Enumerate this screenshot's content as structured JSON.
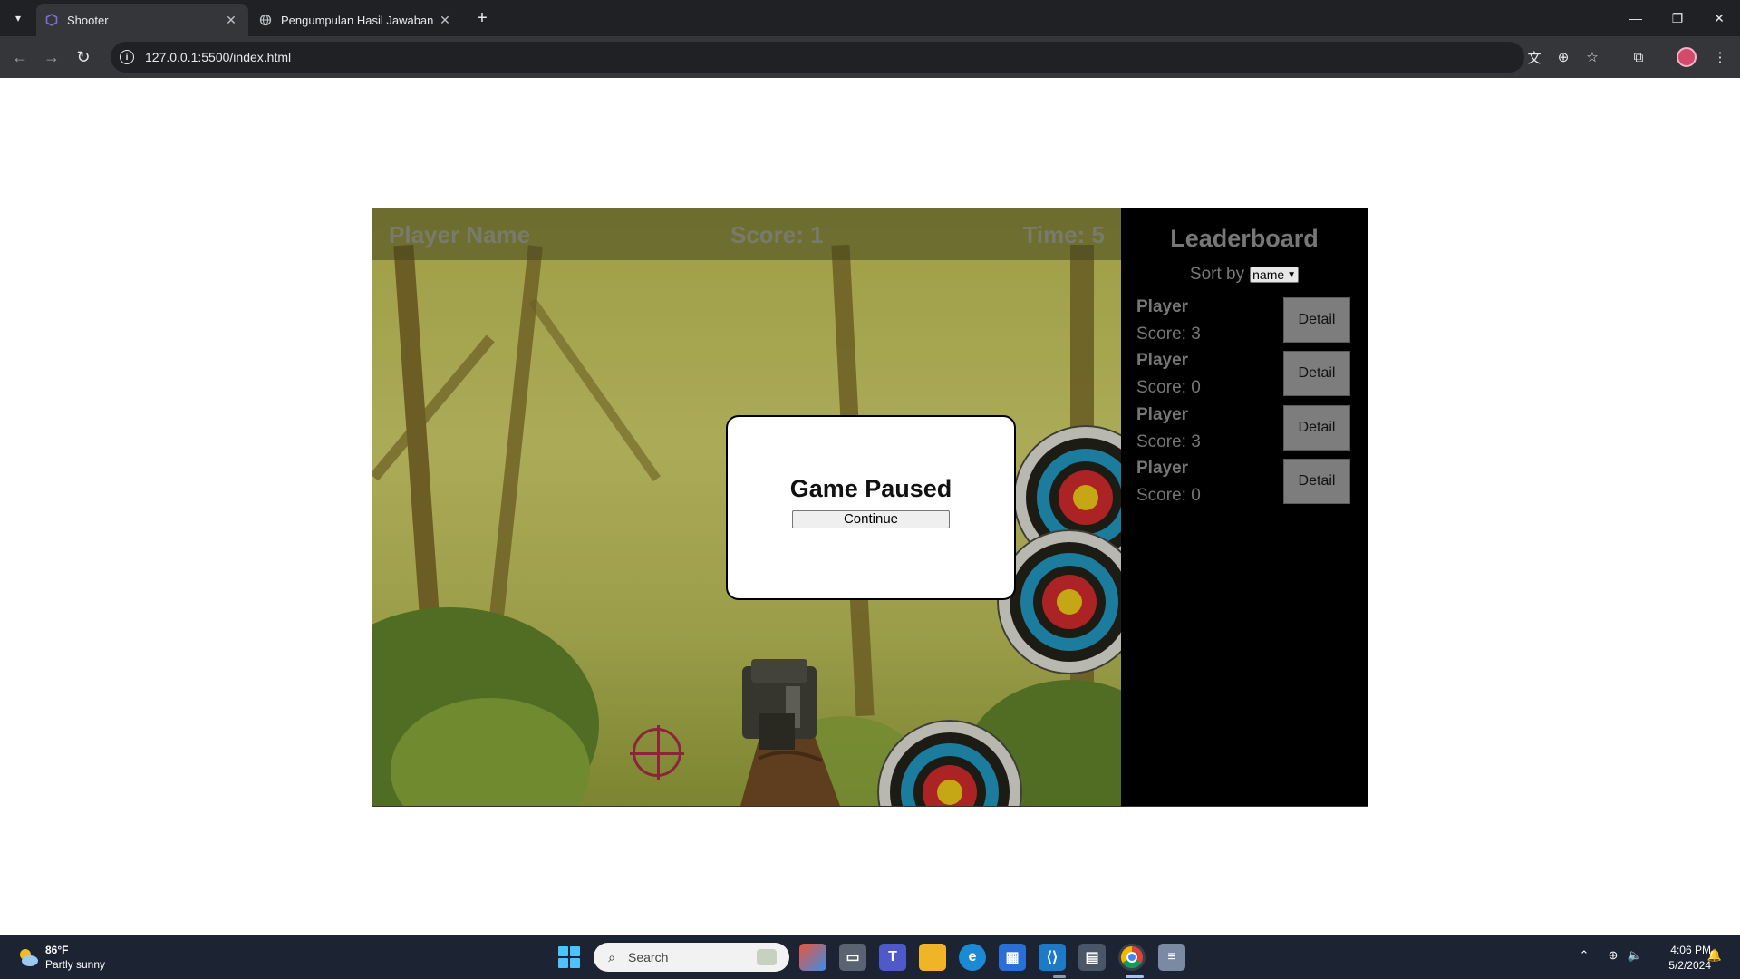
{
  "browser": {
    "tabs": [
      {
        "title": "Shooter",
        "active": true,
        "icon": "shooter-favicon"
      },
      {
        "title": "Pengumpulan Hasil Jawaban LK",
        "active": false,
        "icon": "globe-icon"
      }
    ],
    "url": "127.0.0.1:5500/index.html"
  },
  "game": {
    "hud": {
      "player_name": "Player Name",
      "score": "Score: 1",
      "time": "Time: 5"
    },
    "pause_modal": {
      "title": "Game Paused",
      "continue_label": "Continue"
    },
    "leaderboard": {
      "title": "Leaderboard",
      "sort_label": "Sort by",
      "sort_value": "name",
      "detail_label": "Detail",
      "entries": [
        {
          "name": "Player",
          "score": "Score: 3"
        },
        {
          "name": "Player",
          "score": "Score: 0"
        },
        {
          "name": "Player",
          "score": "Score: 3"
        },
        {
          "name": "Player",
          "score": "Score: 0"
        }
      ]
    }
  },
  "taskbar": {
    "weather": {
      "temp": "86°F",
      "desc": "Partly sunny"
    },
    "search_placeholder": "Search",
    "time": "4:06 PM",
    "date": "5/2/2024"
  },
  "colors": {
    "target_outer": "#d8d8d8",
    "target_black": "#1a1a1a",
    "target_blue": "#1a8fc0",
    "target_red": "#c8232c",
    "target_yellow": "#e8c21a",
    "leaderboard_bg": "#000000",
    "detail_button_bg": "#7d7d7d"
  }
}
